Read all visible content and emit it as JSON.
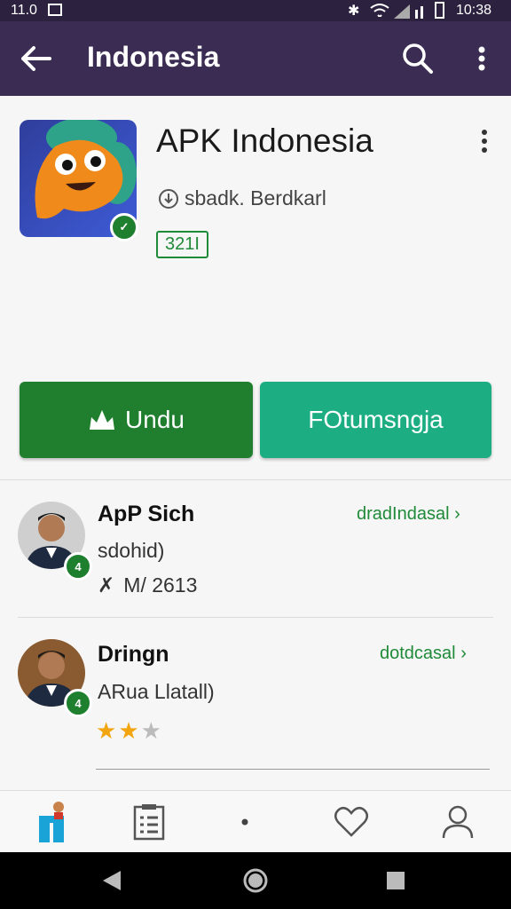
{
  "status_bar": {
    "time_left": "11.0",
    "time_right": "10:38"
  },
  "app_bar": {
    "title": "Indonesia"
  },
  "app": {
    "title": "APK Indonesia",
    "developer": "sbadk. Berdkarl",
    "size": "321I",
    "install_label": "Undu",
    "secondary_label": "FOtumsngja"
  },
  "reviews": [
    {
      "name": "ApP Sich",
      "subtitle": "sdohid)",
      "meta": "M/ 2613",
      "link": "dradIndasal",
      "stars_filled": 0
    },
    {
      "name": "Dringn",
      "subtitle": "ARua Llatall)",
      "meta": "",
      "link": "dotdcasal",
      "stars_filled": 2,
      "stars_total": 3
    }
  ],
  "colors": {
    "status_bar": "#2d2140",
    "app_bar": "#3a2c52",
    "install": "#1f7f2e",
    "secondary": "#1cae82",
    "link": "#1f8a38"
  },
  "bottom_nav": [
    "home-icon",
    "list-icon",
    "dot-icon",
    "heart-icon",
    "profile-icon"
  ]
}
